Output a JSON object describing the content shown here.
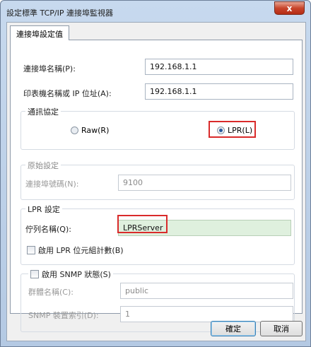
{
  "window": {
    "title": "設定標準 TCP/IP 連接埠監視器",
    "close_label": "x"
  },
  "tab": {
    "label": "連接埠設定值"
  },
  "port_name": {
    "label": "連接埠名稱(P):",
    "value": "192.168.1.1"
  },
  "printer_name": {
    "label": "印表機名稱或 IP 位址(A):",
    "value": "192.168.1.1"
  },
  "protocol": {
    "title": "通訊協定",
    "raw_label": "Raw(R)",
    "lpr_label": "LPR(L)",
    "selected": "LPR"
  },
  "raw_settings": {
    "title": "原始設定",
    "port_number_label": "連接埠號碼(N):",
    "port_number_value": "9100"
  },
  "lpr_settings": {
    "title": "LPR 設定",
    "queue_name_label": "佇列名稱(Q):",
    "queue_name_value": "LPRServer",
    "byte_count_label": "啟用 LPR 位元組計數(B)"
  },
  "snmp": {
    "enable_label": "啟用 SNMP 狀態(S)",
    "community_label": "群體名稱(C):",
    "community_value": "public",
    "device_index_label": "SNMP 裝置索引(D):",
    "device_index_value": "1"
  },
  "buttons": {
    "ok": "確定",
    "cancel": "取消"
  },
  "colors": {
    "highlight": "#d92b2b",
    "active_field": "#dff0de"
  }
}
